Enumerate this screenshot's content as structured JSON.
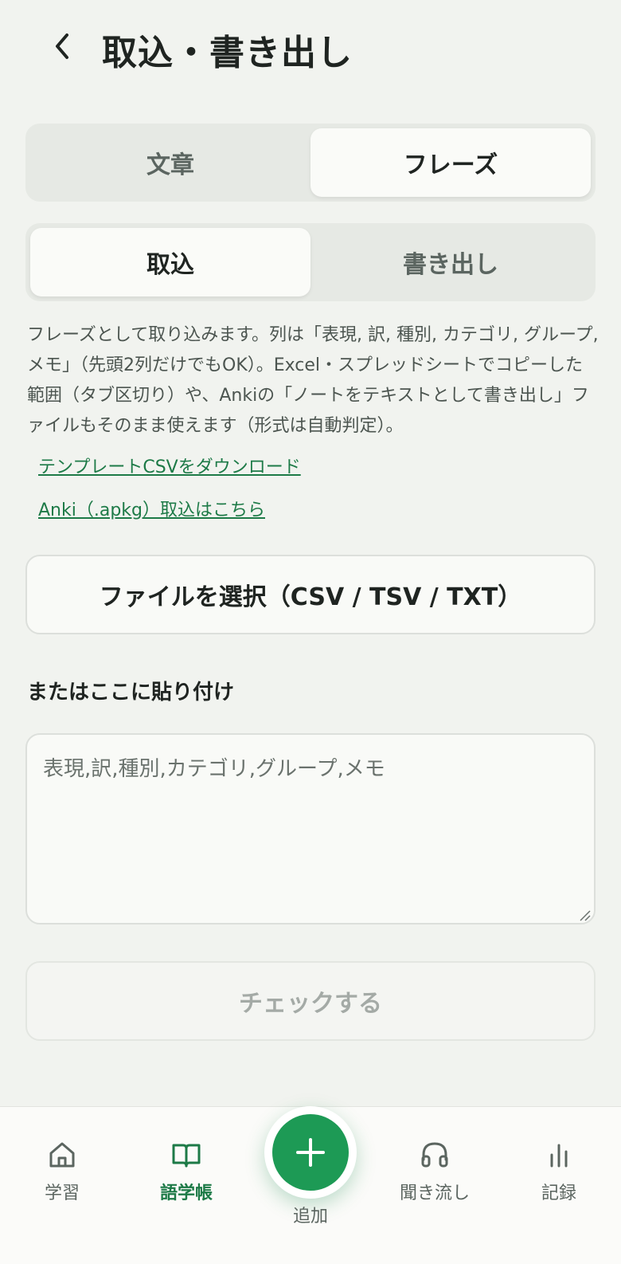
{
  "header": {
    "title": "取込・書き出し",
    "back_icon": "chevron-left-icon"
  },
  "type_tabs": {
    "items": [
      "文章",
      "フレーズ"
    ],
    "selected": "フレーズ"
  },
  "mode_tabs": {
    "items": [
      "取込",
      "書き出し"
    ],
    "selected": "取込"
  },
  "description": "フレーズとして取り込みます。列は「表現, 訳, 種別, カテゴリ, グループ, メモ」（先頭2列だけでもOK）。Excel・スプレッドシートでコピーした範囲（タブ区切り）や、Ankiの「ノートをテキストとして書き出し」ファイルもそのまま使えます（形式は自動判定）。",
  "links": {
    "template_csv": "テンプレートCSVをダウンロード",
    "anki_import": "Anki（.apkg）取込はこちら"
  },
  "file_button": "ファイルを選択（CSV / TSV / TXT）",
  "paste": {
    "label": "またはここに貼り付け",
    "placeholder": "表現,訳,種別,カテゴリ,グループ,メモ",
    "value": ""
  },
  "check_button": "チェックする",
  "bottom_nav": {
    "items": [
      {
        "label": "学習",
        "icon": "home-icon"
      },
      {
        "label": "語学帳",
        "icon": "book-icon"
      },
      {
        "label": "追加",
        "icon": "plus-icon"
      },
      {
        "label": "聞き流し",
        "icon": "headphones-icon"
      },
      {
        "label": "記録",
        "icon": "bar-chart-icon"
      }
    ],
    "active": "語学帳"
  },
  "colors": {
    "accent": "#1d9a55",
    "link": "#1d7a47",
    "background": "#f1f3ef"
  }
}
